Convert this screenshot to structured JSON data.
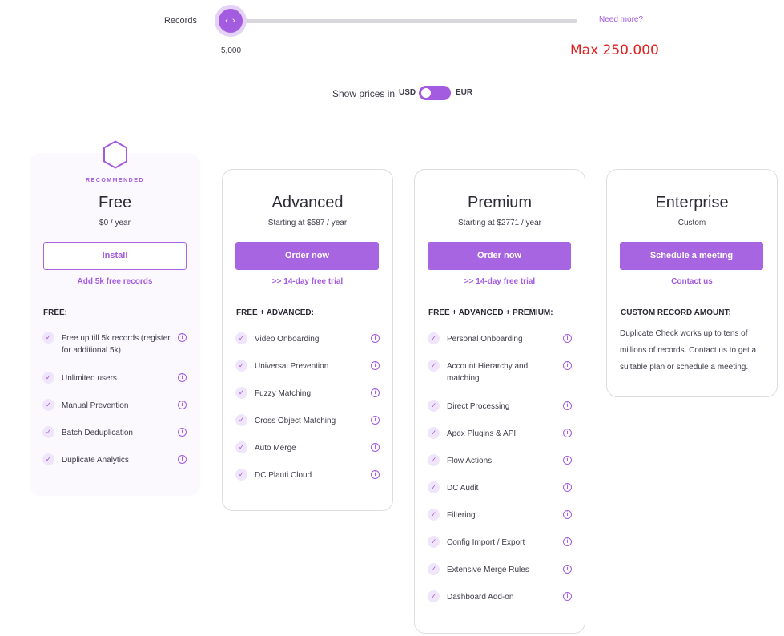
{
  "slider": {
    "label": "Records",
    "thumb_glyph": "‹ ›",
    "value": "5,000",
    "need_more": "Need more?",
    "max_note": "Max 250.000"
  },
  "currency": {
    "show_prices_label": "Show prices in",
    "usd": "USD",
    "eur": "EUR",
    "selected": "USD"
  },
  "colors": {
    "accent": "#a35be0",
    "annotation": "#e02020"
  },
  "plans": {
    "free": {
      "badge": "RECOMMENDED",
      "icon": "hexagon-icon",
      "title": "Free",
      "price": "$0 / year",
      "button": "Install",
      "link": "Add 5k free records",
      "section": "FREE:",
      "features": [
        "Free up till 5k records (register for additional 5k)",
        "Unlimited users",
        "Manual Prevention",
        "Batch Deduplication",
        "Duplicate Analytics"
      ]
    },
    "advanced": {
      "title": "Advanced",
      "price": "Starting at $587 / year",
      "button": "Order now",
      "link": ">> 14-day free trial",
      "section": "FREE + ADVANCED:",
      "features": [
        "Video Onboarding",
        "Universal Prevention",
        "Fuzzy Matching",
        "Cross Object Matching",
        "Auto Merge",
        "DC Plauti Cloud"
      ]
    },
    "premium": {
      "title": "Premium",
      "price": "Starting at $2771 / year",
      "button": "Order now",
      "link": ">> 14-day free trial",
      "section": "FREE + ADVANCED + PREMIUM:",
      "features": [
        "Personal Onboarding",
        "Account Hierarchy and matching",
        "Direct Processing",
        "Apex Plugins & API",
        "Flow Actions",
        "DC Audit",
        "Filtering",
        "Config Import / Export",
        "Extensive Merge Rules",
        "Dashboard Add-on"
      ]
    },
    "enterprise": {
      "title": "Enterprise",
      "price": "Custom",
      "button": "Schedule a meeting",
      "link": "Contact us",
      "section": "CUSTOM RECORD AMOUNT:",
      "description": "Duplicate Check works up to tens of millions of records. Contact us to get a suitable plan or schedule a meeting."
    }
  },
  "glyphs": {
    "check": "✓",
    "info": "i"
  }
}
